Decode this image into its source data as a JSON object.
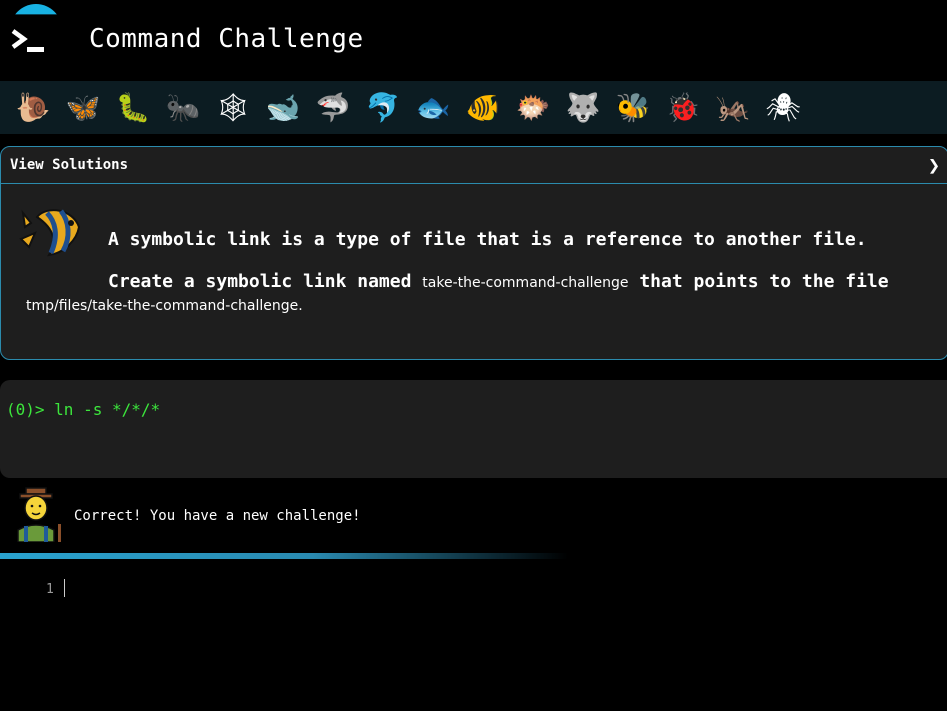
{
  "app": {
    "title": "Command Challenge",
    "accent": "#18b2e3"
  },
  "animals": [
    {
      "name": "snail",
      "glyph": "🐌"
    },
    {
      "name": "butterfly",
      "glyph": "🦋"
    },
    {
      "name": "caterpillar",
      "glyph": "🐛"
    },
    {
      "name": "ant",
      "glyph": "🐜"
    },
    {
      "name": "spider-web",
      "glyph": "🕸"
    },
    {
      "name": "whale",
      "glyph": "🐋"
    },
    {
      "name": "shark",
      "glyph": "🦈"
    },
    {
      "name": "dolphin",
      "glyph": "🐬"
    },
    {
      "name": "fish",
      "glyph": "🐟"
    },
    {
      "name": "tropical-fish",
      "glyph": "🐠"
    },
    {
      "name": "blowfish",
      "glyph": "🐡"
    },
    {
      "name": "wolf",
      "glyph": "🐺"
    },
    {
      "name": "bee",
      "glyph": "🐝"
    },
    {
      "name": "ladybug",
      "glyph": "🐞"
    },
    {
      "name": "cricket",
      "glyph": "🦗"
    },
    {
      "name": "spider",
      "glyph": "🕷"
    }
  ],
  "challenge": {
    "header_label": "View Solutions",
    "chevron": "❯",
    "line1": "A symbolic link is a type of file that is a reference to another file.",
    "line2_prefix": "Create a symbolic link named ",
    "line2_code": "take-the-command-challenge",
    "line2_suffix": " that points to the file",
    "line3": "tmp/files/take-the-command-challenge."
  },
  "terminal": {
    "prompt": "(0)> ",
    "command": "ln -s */*/*"
  },
  "feedback": {
    "message": "Correct! You have a new challenge!",
    "progress": 0.6
  },
  "editor": {
    "line_number": "1"
  }
}
